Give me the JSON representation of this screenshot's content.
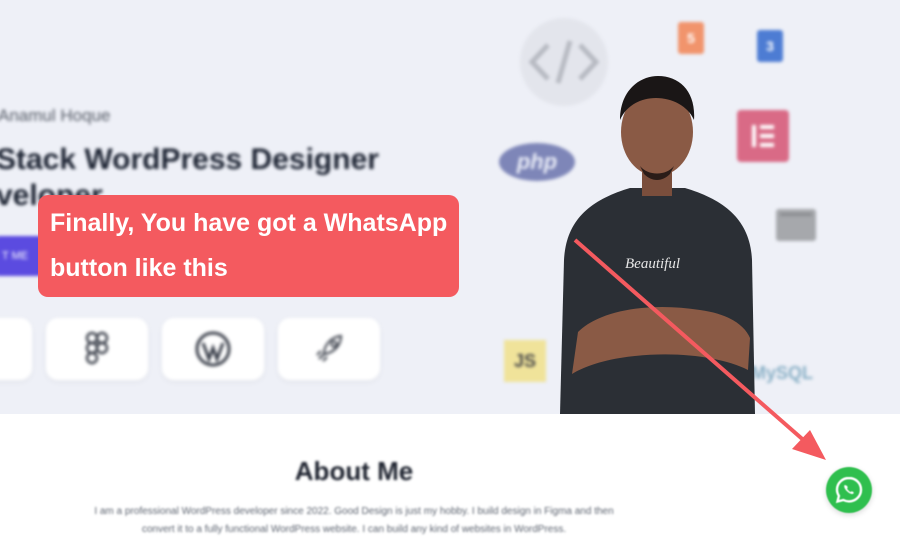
{
  "hero": {
    "intro": "Anamul Hoque",
    "headline_line1": "Stack WordPress Designer",
    "headline_line2": "veloper",
    "cta_label": "T ME"
  },
  "tech_icons": {
    "php_label": "php",
    "js_label": "JS",
    "mysql_label": "MySQL",
    "html_label": "5",
    "css_label": "3"
  },
  "callout": {
    "line1": "Finally, You have got a WhatsApp",
    "line2": "button like this"
  },
  "about": {
    "title": "About Me",
    "text_line1": "I am a professional WordPress developer since 2022. Good Design is just my hobby. I build design in Figma and then",
    "text_line2": "convert it to a fully functional WordPress website. I can build any kind of websites in WordPress."
  },
  "colors": {
    "callout": "#f45a5f",
    "whatsapp": "#2fbf4e",
    "accent": "#5b4be0"
  }
}
